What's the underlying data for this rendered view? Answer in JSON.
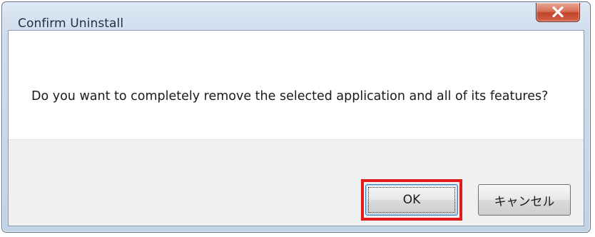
{
  "window": {
    "title": "Confirm Uninstall"
  },
  "titlebar": {
    "close_icon": "close-icon"
  },
  "message": {
    "text": "Do you want to completely remove the selected application and all of its features?"
  },
  "buttons": {
    "ok_label": "OK",
    "cancel_label": "キャンセル"
  },
  "colors": {
    "highlight": "#e01b1b",
    "close_button": "#c0462c"
  }
}
